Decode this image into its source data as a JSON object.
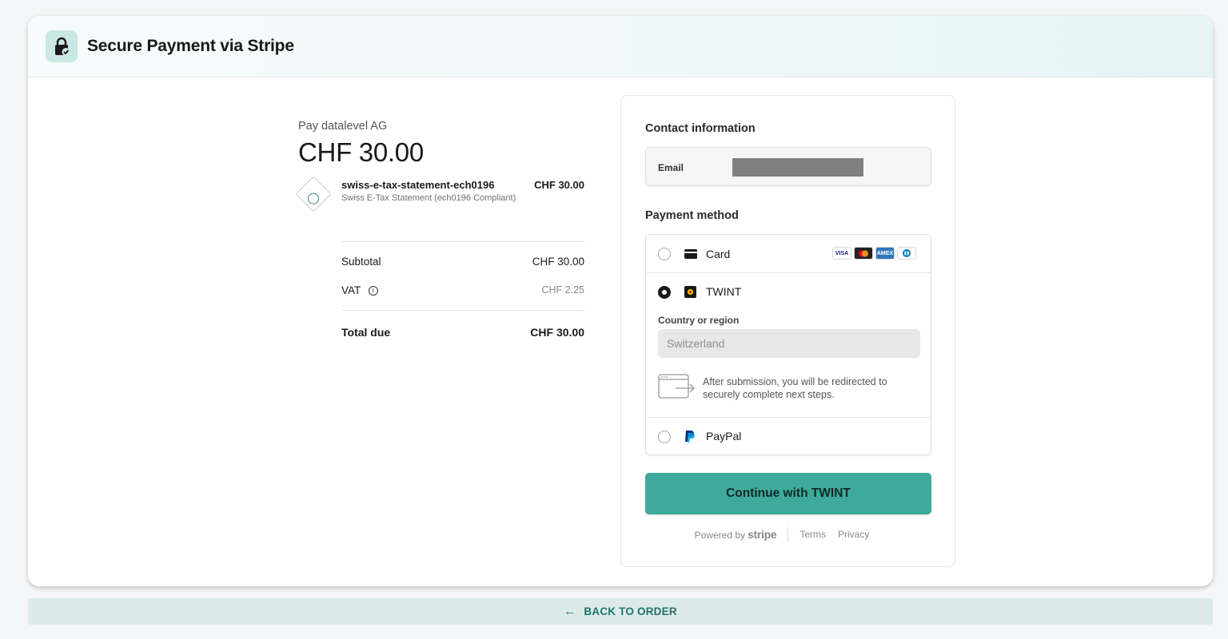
{
  "header": {
    "title": "Secure Payment via Stripe",
    "icon": "lock-check-icon"
  },
  "summary": {
    "pay_to": "Pay datalevel AG",
    "amount": "CHF 30.00",
    "item": {
      "name": "swiss-e-tax-statement-ech0196",
      "description": "Swiss E-Tax Statement (ech0196 Compliant)",
      "price": "CHF 30.00"
    },
    "subtotal_label": "Subtotal",
    "subtotal_value": "CHF 30.00",
    "vat_label": "VAT",
    "vat_value": "CHF 2.25",
    "total_label": "Total due",
    "total_value": "CHF 30.00"
  },
  "form": {
    "contact_title": "Contact information",
    "email_label": "Email",
    "payment_title": "Payment method",
    "methods": {
      "card_label": "Card",
      "card_brands": [
        "VISA",
        "mastercard",
        "AMEX",
        "diners"
      ],
      "twint_label": "TWINT",
      "paypal_label": "PayPal",
      "selected": "TWINT"
    },
    "country_label": "Country or region",
    "country_value": "Switzerland",
    "redirect_text": "After submission, you will be redirected to securely complete next steps.",
    "submit_label": "Continue with TWINT",
    "powered_by": "Powered by",
    "stripe": "stripe",
    "terms": "Terms",
    "privacy": "Privacy"
  },
  "back": {
    "label": "BACK TO ORDER"
  },
  "colors": {
    "accent": "#3faa9c",
    "back_bar": "#dcebea",
    "back_text": "#1f7468"
  }
}
